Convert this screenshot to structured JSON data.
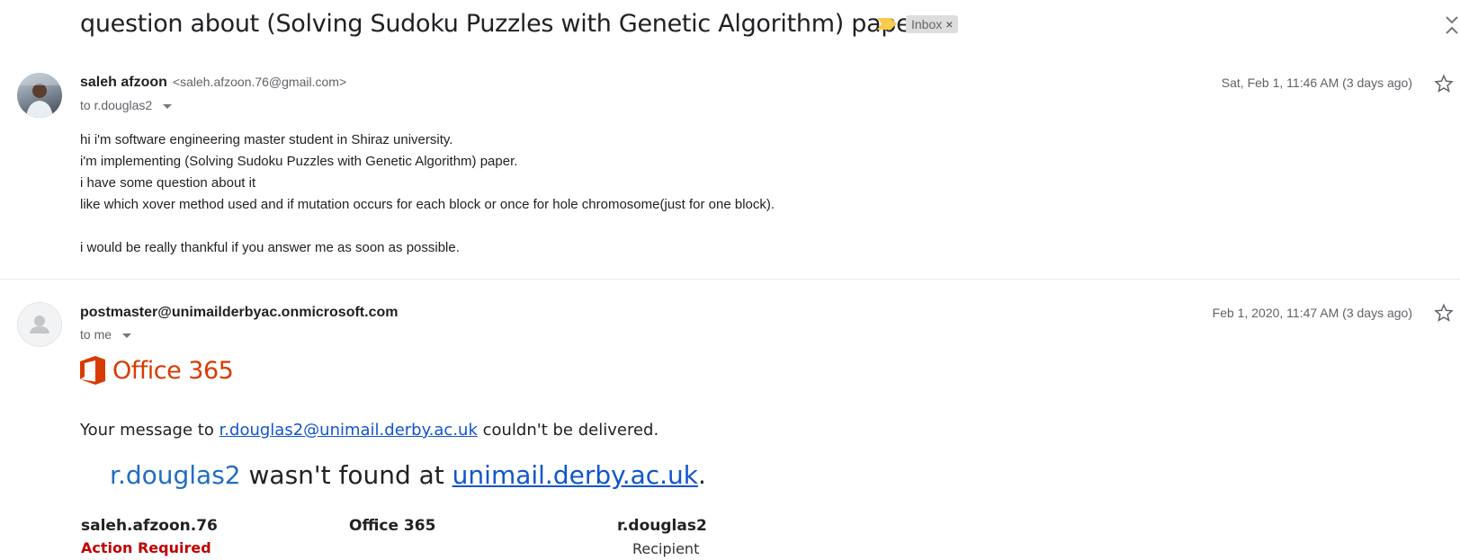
{
  "thread": {
    "subject": "question about (Solving Sudoku Puzzles with Genetic Algorithm) paper",
    "label_chip": "Inbox",
    "label_close": "×"
  },
  "messages": [
    {
      "sender_name": "saleh afzoon",
      "sender_email": "<saleh.afzoon.76@gmail.com>",
      "to": "to r.douglas2",
      "date": "Sat, Feb 1, 11:46 AM (3 days ago)",
      "body_lines": [
        "hi i'm software engineering master student in Shiraz university.",
        "i'm implementing (Solving Sudoku Puzzles with Genetic Algorithm) paper.",
        "i have some question about it",
        "like which xover method used and if mutation occurs for each block or once for hole chromosome(just for one block).",
        "",
        "i would be really thankful if you answer me as soon as possible."
      ]
    },
    {
      "sender_name": "postmaster@unimailderbyac.onmicrosoft.com",
      "to": "to me",
      "date": "Feb 1, 2020, 11:47 AM (3 days ago)",
      "logo_text": "Office 365",
      "ndr": {
        "line1_prefix": "Your message to ",
        "line1_link": "r.douglas2@unimail.derby.ac.uk",
        "line1_suffix": " couldn't be delivered.",
        "line2_user": "r.douglas2",
        "line2_middle": " wasn't found at ",
        "line2_link": "unimail.derby.ac.uk",
        "line2_suffix": "."
      },
      "flow": [
        {
          "name": "saleh.afzoon.76",
          "sub": "Action Required"
        },
        {
          "name": "Office 365",
          "sub": ""
        },
        {
          "name": "r.douglas2",
          "sub": "Recipient"
        }
      ]
    }
  ],
  "colors": {
    "office_orange": "#d83b01",
    "link_blue": "#1155cc",
    "action_red": "#c00000",
    "importance_yellow": "#f7cb4d"
  }
}
